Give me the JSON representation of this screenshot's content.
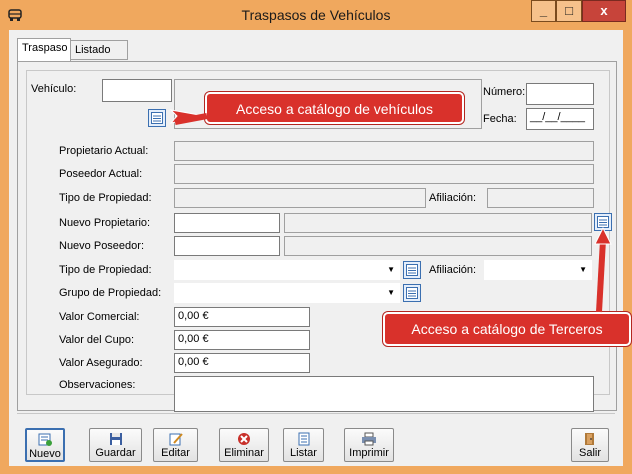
{
  "window": {
    "title": "Traspasos de Vehículos",
    "minimize_glyph": "_",
    "maximize_glyph": "□",
    "close_glyph": "x",
    "accent_color": "#f0a85e",
    "callout_color": "#d9312b"
  },
  "tabs": [
    {
      "label": "Traspaso",
      "active": true
    },
    {
      "label": "Listado",
      "active": false
    }
  ],
  "form": {
    "vehiculo_label": "Vehículo:",
    "vehiculo_value": "",
    "numero_label": "Número:",
    "numero_value": "",
    "fecha_label": "Fecha:",
    "fecha_value": "__/__/____",
    "propietario_actual_label": "Propietario Actual:",
    "poseedor_actual_label": "Poseedor Actual:",
    "tipo_propiedad_ro_label": "Tipo de Propiedad:",
    "afiliacion_ro_label": "Afiliación:",
    "nuevo_propietario_label": "Nuevo Propietario:",
    "nuevo_poseedor_label": "Nuevo Poseedor:",
    "tipo_propiedad_label": "Tipo de Propiedad:",
    "afiliacion_label": "Afiliación:",
    "grupo_propiedad_label": "Grupo de Propiedad:",
    "valor_comercial_label": "Valor Comercial:",
    "valor_comercial_value": "0,00 €",
    "valor_cupo_label": "Valor del Cupo:",
    "valor_cupo_value": "0,00 €",
    "valor_asegurado_label": "Valor Asegurado:",
    "valor_asegurado_value": "0,00 €",
    "observaciones_label": "Observaciones:"
  },
  "callouts": {
    "vehicle_catalog": "Acceso a catálogo de vehículos",
    "third_party_catalog": "Acceso a catálogo de Terceros"
  },
  "toolbar": {
    "nuevo": "Nuevo",
    "guardar": "Guardar",
    "editar": "Editar",
    "eliminar": "Eliminar",
    "listar": "Listar",
    "imprimir": "Imprimir",
    "salir": "Salir"
  },
  "icons": [
    "car-icon",
    "catalog-icon",
    "new-icon",
    "save-icon",
    "edit-icon",
    "delete-icon",
    "list-icon",
    "print-icon",
    "exit-icon"
  ]
}
